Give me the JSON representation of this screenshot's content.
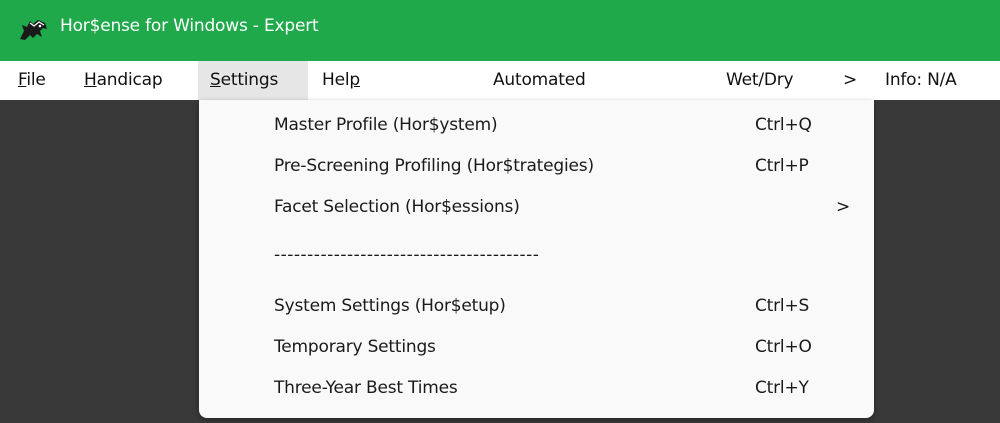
{
  "window": {
    "title": "Hor$ense for Windows - Expert",
    "icon": "horse-head-icon",
    "titlebar_color": "#1fa94b",
    "body_color": "#393939"
  },
  "menubar": {
    "file": "File",
    "file_acc": "F",
    "file_rest": "ile",
    "handicap_acc": "H",
    "handicap_rest": "andicap",
    "settings_acc": "S",
    "settings_rest": "ettings",
    "help_pre": "Hel",
    "help_acc": "p",
    "automated": "Automated",
    "wetdry": "Wet/Dry",
    "arrow": ">",
    "info": "Info: N/A"
  },
  "settings_menu": {
    "items": [
      {
        "label": "Master Profile (Hor$ystem)",
        "shortcut": "Ctrl+Q"
      },
      {
        "label": "Pre-Screening Profiling (Hor$trategies)",
        "shortcut": "Ctrl+P"
      },
      {
        "label": "Facet Selection (Hor$essions)",
        "submenu": ">"
      },
      {
        "label": "System Settings (Hor$etup)",
        "shortcut": "Ctrl+S"
      },
      {
        "label": "Temporary Settings",
        "shortcut": "Ctrl+O"
      },
      {
        "label": "Three-Year Best Times",
        "shortcut": "Ctrl+Y"
      }
    ],
    "separator": "----------------------------------------"
  }
}
